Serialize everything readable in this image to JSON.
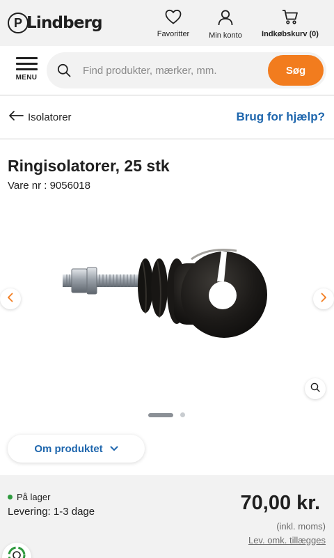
{
  "header": {
    "logo_initial": "P",
    "logo_text": "Lindberg",
    "favorites_label": "Favoritter",
    "account_label": "Min konto",
    "cart_label": "Indkøbskurv (0)"
  },
  "search": {
    "menu_label": "MENU",
    "placeholder": "Find produkter, mærker, mm.",
    "button_label": "Søg"
  },
  "breadcrumb": {
    "label": "Isolatorer",
    "help_label": "Brug for hjælp?"
  },
  "product": {
    "title": "Ringisolatorer, 25 stk",
    "sku": "Vare nr : 9056018",
    "image_count": 2,
    "active_image": 1,
    "about_label": "Om produktet"
  },
  "buybox": {
    "stock_status": "På lager",
    "delivery": "Levering: 1-3 dage",
    "price": "70,00 kr.",
    "vat_note": "(inkl. moms)",
    "shipping_link": "Lev. omk. tillægges"
  },
  "colors": {
    "accent_orange": "#f27c1e",
    "link_blue": "#1e66ad",
    "stock_green": "#2e9a3e",
    "header_bg": "#f2f2f2"
  },
  "icons": {
    "favorites": "heart-icon",
    "account": "user-icon",
    "cart": "cart-icon",
    "menu": "hamburger-icon",
    "search": "search-icon",
    "back": "arrow-left-icon",
    "prev": "chevron-left-icon",
    "next": "chevron-right-icon",
    "zoom": "zoom-icon",
    "about": "chevron-down-icon",
    "eco": "recycle-icon"
  }
}
